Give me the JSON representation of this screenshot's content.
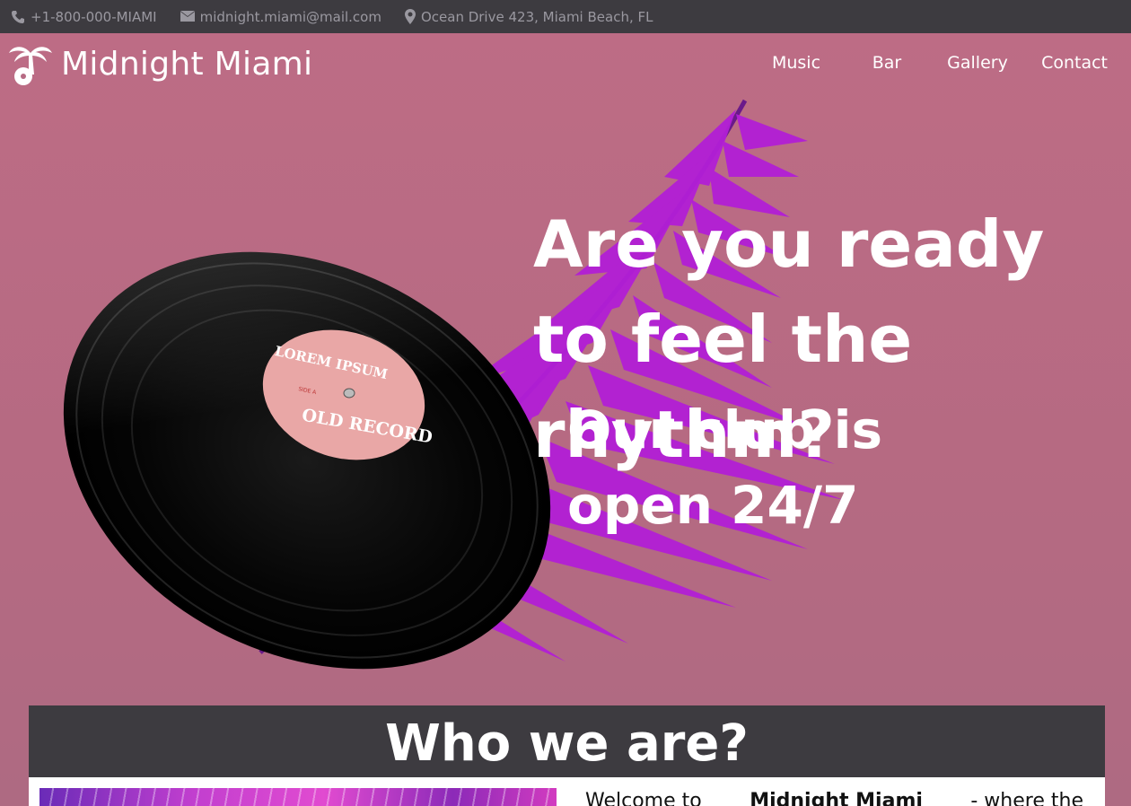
{
  "topbar": {
    "phone": "+1-800-000-MIAMI",
    "email": "midnight.miami@mail.com",
    "address": "Ocean Drive 423, Miami Beach, FL",
    "icons": [
      "phone-icon",
      "envelope-icon",
      "map-pin-icon"
    ]
  },
  "brand": {
    "name": "Midnight Miami",
    "logo_icon": "palm-tree-record-icon"
  },
  "nav": {
    "items": [
      {
        "label": "Music"
      },
      {
        "label": "Bar"
      },
      {
        "label": "Gallery"
      },
      {
        "label": "Contact"
      }
    ]
  },
  "hero": {
    "headline": "Are you ready to feel the rhythm?",
    "subline": "Our club is open 24/7",
    "record_label_top": "LOREM IPSUM",
    "record_label_bottom": "OLD RECORD",
    "record_side": "SIDE A"
  },
  "about": {
    "heading": "Who we are?",
    "intro_prefix": "Welcome to",
    "intro_brand": "Midnight Miami",
    "intro_suffix": "- where the"
  },
  "colors": {
    "topbar_bg": "#3d3b40",
    "hero_bg": "#b76b84",
    "palm": "#b21fd6",
    "label_pink": "#e9a7a6"
  }
}
